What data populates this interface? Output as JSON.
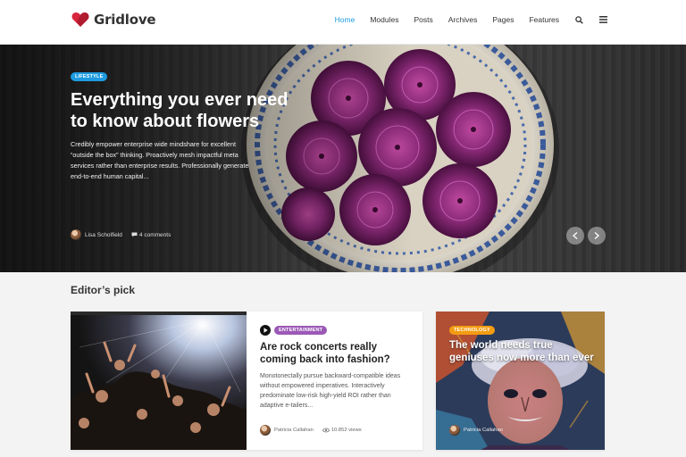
{
  "header": {
    "logo_text": "Gridlove",
    "nav": [
      {
        "label": "Home",
        "active": true
      },
      {
        "label": "Modules",
        "active": false
      },
      {
        "label": "Posts",
        "active": false
      },
      {
        "label": "Archives",
        "active": false
      },
      {
        "label": "Pages",
        "active": false
      },
      {
        "label": "Features",
        "active": false
      }
    ],
    "icons": [
      "search-icon",
      "menu-icon"
    ],
    "accent_color": "#1e9be0"
  },
  "hero": {
    "category": "LIFESTYLE",
    "title": "Everything you ever need to know about flowers",
    "excerpt": "Credibly empower enterprise wide mindshare for excellent “outside the box” thinking. Proactively mesh impactful meta services rather than enterprise results. Professionally generate end-to-end human capital...",
    "author": "Lisa Scholfield",
    "comments": "4 comments"
  },
  "editors_pick": {
    "title": "Editor’s pick",
    "main_card": {
      "category": "ENTERTAINMENT",
      "title": "Are rock concerts really coming back into fashion?",
      "excerpt": "Monotonectally pursue backward-compatible ideas without empowered imperatives. Interactively predominate low-risk high-yield ROI rather than adaptive e-tailers...",
      "author": "Patricia Callahan",
      "views": "10.852 views"
    },
    "side_card": {
      "category": "TECHNOLOGY",
      "title": "The world needs true geniuses now more than ever",
      "author": "Patricia Callahan"
    }
  },
  "colors": {
    "lifestyle": "#1e9be0",
    "entertainment": "#9b59b6",
    "technology": "#f39c12"
  }
}
